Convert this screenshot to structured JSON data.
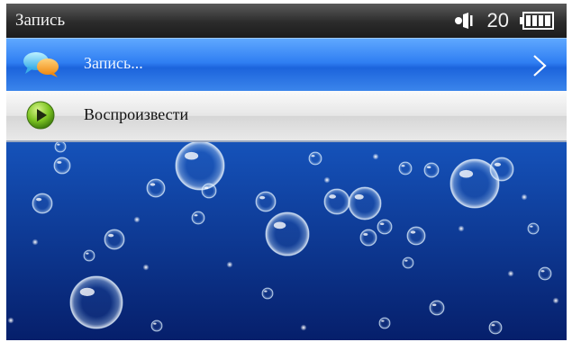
{
  "status_bar": {
    "title": "Запись",
    "volume_level": "20",
    "icons": [
      "speaker-icon",
      "battery-icon"
    ]
  },
  "menu": {
    "items": [
      {
        "label": "Запись...",
        "icon": "chat-bubbles-icon",
        "selected": true,
        "has_submenu": true
      },
      {
        "label": "Воспроизвести",
        "icon": "play-icon",
        "selected": false,
        "has_submenu": false
      }
    ]
  },
  "colors": {
    "highlight": "#2f7ef2",
    "background": "#0a2f8a",
    "statusbar": "#2b2b2b"
  }
}
